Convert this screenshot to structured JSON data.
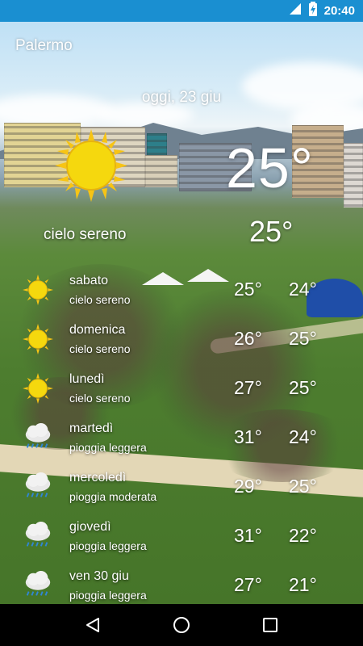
{
  "status_bar": {
    "time": "20:40",
    "bar_color": "#1a8fd1",
    "icons": [
      "signal-icon",
      "battery-charging-icon"
    ]
  },
  "app": {
    "city": "Palermo",
    "date": "oggi, 23 giu",
    "current_temp": "25°",
    "current_icon": "sun-icon",
    "current_condition": "cielo sereno",
    "feels_temp": "25°"
  },
  "forecast": [
    {
      "day": "sabato",
      "condition": "cielo sereno",
      "max": "25°",
      "min": "24°",
      "icon": "sun-icon"
    },
    {
      "day": "domenica",
      "condition": "cielo sereno",
      "max": "26°",
      "min": "25°",
      "icon": "sun-icon"
    },
    {
      "day": "lunedì",
      "condition": "cielo sereno",
      "max": "27°",
      "min": "25°",
      "icon": "sun-icon"
    },
    {
      "day": "martedì",
      "condition": "pioggia leggera",
      "max": "31°",
      "min": "24°",
      "icon": "rain-cloud-icon"
    },
    {
      "day": "mercoledì",
      "condition": "pioggia moderata",
      "max": "29°",
      "min": "25°",
      "icon": "rain-cloud-icon"
    },
    {
      "day": "giovedì",
      "condition": "pioggia leggera",
      "max": "31°",
      "min": "22°",
      "icon": "rain-cloud-icon"
    },
    {
      "day": "ven 30 giu",
      "condition": "pioggia leggera",
      "max": "27°",
      "min": "21°",
      "icon": "rain-cloud-icon"
    }
  ],
  "nav_bar": {
    "buttons": [
      "back-icon",
      "home-icon",
      "recents-icon"
    ]
  }
}
